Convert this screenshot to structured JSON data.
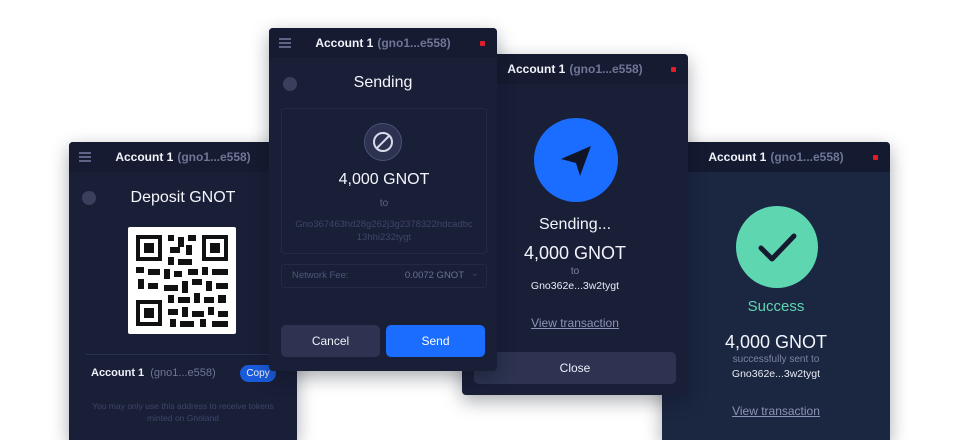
{
  "deposit": {
    "account_name": "Account 1",
    "account_short": "(gno1...e558)",
    "title": "Deposit GNOT",
    "footer_account": "Account 1",
    "footer_short": "(gno1...e558)",
    "copy_label": "Copy",
    "note": "You may only use this address to receive tokens minted on Gnoland"
  },
  "sending": {
    "account_name": "Account 1",
    "account_short": "(gno1...e558)",
    "title": "Sending",
    "amount": "4,000 GNOT",
    "to_label": "to",
    "address": "Gno367463hd28g262j3g2378322hdcadbc13hhi232tygt",
    "fee_label": "Network Fee:",
    "fee_value": "0.0072 GNOT",
    "cancel_label": "Cancel",
    "send_label": "Send"
  },
  "progress": {
    "account_name": "Account 1",
    "account_short": "(gno1...e558)",
    "status": "Sending...",
    "amount": "4,000 GNOT",
    "to_label": "to",
    "address": "Gno362e...3w2tygt",
    "view_link": "View transaction",
    "close_label": "Close"
  },
  "success": {
    "account_name": "Account 1",
    "account_short": "(gno1...e558)",
    "status": "Success",
    "amount": "4,000 GNOT",
    "sent_to_label": "successfully sent to",
    "address": "Gno362e...3w2tygt",
    "view_link": "View transaction"
  },
  "colors": {
    "card_bg": "#1a1f38",
    "accent_blue": "#1a6dff",
    "success_green": "#5ed7b1",
    "status_red": "#e11d2a"
  }
}
